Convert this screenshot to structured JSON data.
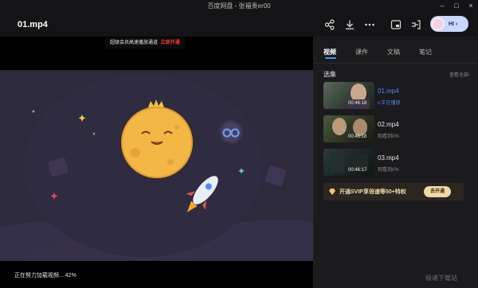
{
  "window": {
    "title": "百度网盘 - 张福贵er00",
    "controls": {
      "minimize": "–",
      "maximize": "□",
      "close": "×"
    }
  },
  "header": {
    "file_title": "01.mp4",
    "icons": [
      "share-icon",
      "download-icon",
      "more-icon",
      "picture-in-picture-icon",
      "cast-icon"
    ],
    "user_button": {
      "label": "HI",
      "arrow": "›"
    }
  },
  "player": {
    "vip_banner": {
      "text": "超级会员高速播放通道",
      "action": "立即开通"
    },
    "loading_text": "正在努力加载视频... 42%",
    "loading_progress": 0.42
  },
  "panel": {
    "tabs": [
      {
        "label": "视频",
        "active": true
      },
      {
        "label": "课件",
        "active": false
      },
      {
        "label": "文稿",
        "active": false
      },
      {
        "label": "笔记",
        "active": false
      }
    ],
    "section_title": "选集",
    "see_all": "查看全部",
    "episodes": [
      {
        "name": "01.mp4",
        "status": "正在播放",
        "duration": "00:46:18",
        "active": true
      },
      {
        "name": "02.mp4",
        "status": "观看到0%",
        "duration": "00:46:18",
        "active": false
      },
      {
        "name": "03.mp4",
        "status": "观看到0%",
        "duration": "00:46:17",
        "active": false
      }
    ],
    "svip": {
      "text": "开通SVIP享倍速等50+特权",
      "button": "去开通"
    }
  },
  "watermark": "极速下载站",
  "colors": {
    "accent": "#4b8cff",
    "vip_red": "#ff3b30",
    "svip_gold": "#f1d7a4"
  }
}
